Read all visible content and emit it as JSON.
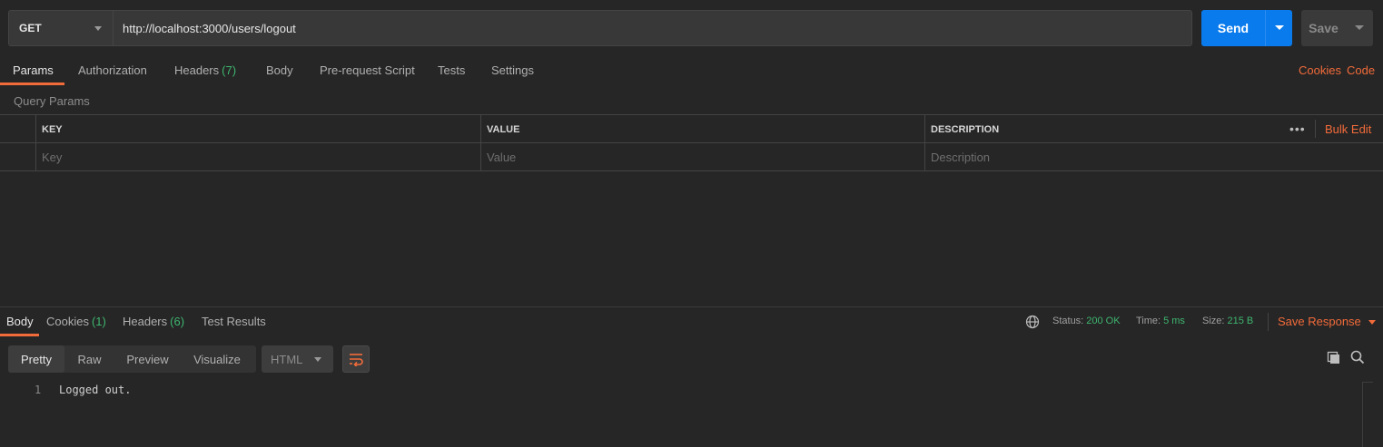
{
  "request": {
    "method": "GET",
    "url": "http://localhost:3000/users/logout",
    "send_label": "Send",
    "save_label": "Save"
  },
  "request_tabs": [
    {
      "label": "Params",
      "active": true
    },
    {
      "label": "Authorization"
    },
    {
      "label": "Headers",
      "count": "(7)"
    },
    {
      "label": "Body"
    },
    {
      "label": "Pre-request Script"
    },
    {
      "label": "Tests"
    },
    {
      "label": "Settings"
    }
  ],
  "request_links": {
    "cookies": "Cookies",
    "code": "Code"
  },
  "params": {
    "section_label": "Query Params",
    "columns": [
      "KEY",
      "VALUE",
      "DESCRIPTION"
    ],
    "placeholders": [
      "Key",
      "Value",
      "Description"
    ],
    "bulk_edit": "Bulk Edit",
    "more": "•••"
  },
  "response_tabs": [
    {
      "label": "Body",
      "active": true
    },
    {
      "label": "Cookies",
      "count": "(1)"
    },
    {
      "label": "Headers",
      "count": "(6)"
    },
    {
      "label": "Test Results"
    }
  ],
  "response_meta": {
    "status_label": "Status:",
    "status_value": "200 OK",
    "time_label": "Time:",
    "time_value": "5 ms",
    "size_label": "Size:",
    "size_value": "215 B",
    "save_response": "Save Response"
  },
  "view_modes": [
    "Pretty",
    "Raw",
    "Preview",
    "Visualize"
  ],
  "active_view": "Pretty",
  "format": "HTML",
  "response_body": [
    {
      "line": "1",
      "text": "Logged out."
    }
  ],
  "colors": {
    "accent": "#f26b3a",
    "send": "#097bed",
    "success": "#3eb56f",
    "background": "#262626"
  }
}
